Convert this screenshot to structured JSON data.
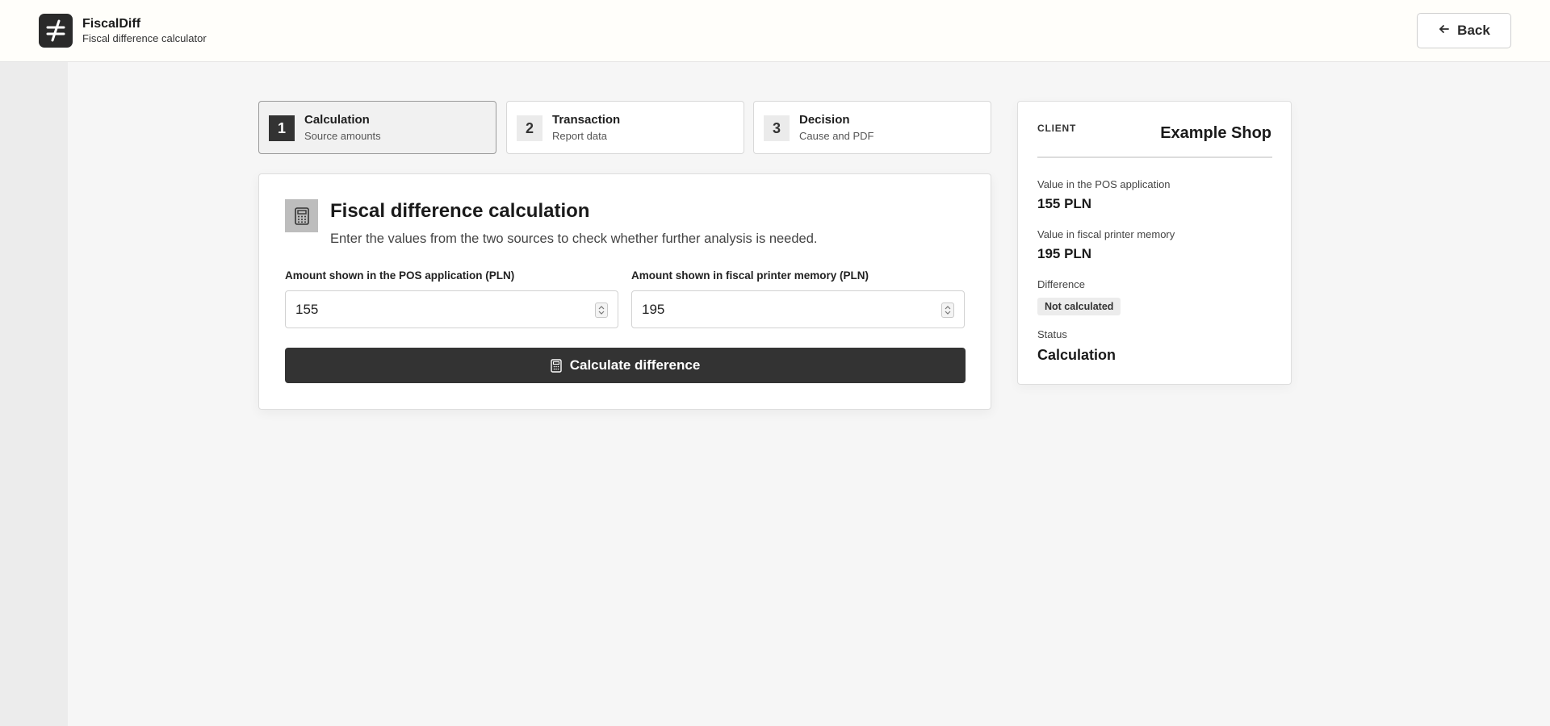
{
  "header": {
    "app_name": "FiscalDiff",
    "app_subtitle": "Fiscal difference calculator",
    "logo_icon": "not-equal-icon",
    "back_label": "Back"
  },
  "steps": [
    {
      "number": "1",
      "title": "Calculation",
      "subtitle": "Source amounts",
      "active": true
    },
    {
      "number": "2",
      "title": "Transaction",
      "subtitle": "Report data",
      "active": false
    },
    {
      "number": "3",
      "title": "Decision",
      "subtitle": "Cause and PDF",
      "active": false
    }
  ],
  "calculation": {
    "icon": "calculator-icon",
    "title": "Fiscal difference calculation",
    "description": "Enter the values from the two sources to check whether further analysis is needed.",
    "pos_label": "Amount shown in the POS application (PLN)",
    "pos_value": "155",
    "printer_label": "Amount shown in fiscal printer memory (PLN)",
    "printer_value": "195",
    "button_label": "Calculate difference"
  },
  "client": {
    "label": "CLIENT",
    "name": "Example Shop",
    "pos_label": "Value in the POS application",
    "pos_value": "155 PLN",
    "printer_label": "Value in fiscal printer memory",
    "printer_value": "195 PLN",
    "difference_label": "Difference",
    "difference_badge": "Not calculated",
    "status_label": "Status",
    "status_value": "Calculation"
  },
  "colors": {
    "primary": "#333333",
    "background": "#f6f6f6",
    "header_bg": "#fffefa"
  }
}
